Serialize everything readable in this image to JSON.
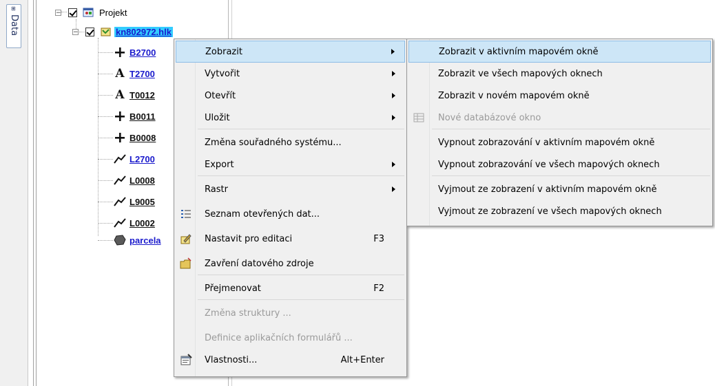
{
  "side_tab": {
    "label": "Data"
  },
  "tree": {
    "root": {
      "label": "Projekt"
    },
    "selected": {
      "label": "kn802972.hlk"
    },
    "layers": [
      {
        "name": "B2700",
        "icon": "plus",
        "color": "link"
      },
      {
        "name": "T2700",
        "icon": "text-A",
        "color": "link"
      },
      {
        "name": "T0012",
        "icon": "text-A",
        "color": "dark"
      },
      {
        "name": "B0011",
        "icon": "plus",
        "color": "dark"
      },
      {
        "name": "B0008",
        "icon": "plus",
        "color": "dark"
      },
      {
        "name": "L2700",
        "icon": "line",
        "color": "link"
      },
      {
        "name": "L0008",
        "icon": "line",
        "color": "dark"
      },
      {
        "name": "L9005",
        "icon": "line",
        "color": "dark"
      },
      {
        "name": "L0002",
        "icon": "line",
        "color": "dark"
      },
      {
        "name": "parcela",
        "icon": "polygon",
        "color": "link"
      }
    ]
  },
  "context_menu": {
    "items": [
      {
        "label": "Zobrazit",
        "submenu": true,
        "highlighted": true
      },
      {
        "label": "Vytvořit",
        "submenu": true
      },
      {
        "label": "Otevřít",
        "submenu": true
      },
      {
        "label": "Uložit",
        "submenu": true
      },
      {
        "label": "Změna souřadného systému..."
      },
      {
        "label": "Export",
        "submenu": true
      },
      {
        "label": "Rastr",
        "submenu": true
      },
      {
        "label": "Seznam otevřených dat...",
        "icon": "list-icon"
      },
      {
        "label": "Nastavit pro editaci",
        "shortcut": "F3",
        "icon": "edit-icon"
      },
      {
        "label": "Zavření datového zdroje",
        "icon": "folder-close-icon"
      },
      {
        "label": "Přejmenovat",
        "shortcut": "F2"
      },
      {
        "label": "Změna struktury ...",
        "disabled": true
      },
      {
        "label": "Definice aplikačních formulářů ...",
        "disabled": true
      },
      {
        "label": "Vlastnosti...",
        "shortcut": "Alt+Enter",
        "icon": "properties-icon"
      }
    ]
  },
  "submenu": {
    "items": [
      {
        "label": "Zobrazit v aktivním mapovém okně",
        "highlighted": true
      },
      {
        "label": "Zobrazit ve všech mapových oknech"
      },
      {
        "label": "Zobrazit v novém mapovém okně"
      },
      {
        "label": "Nové databázové okno",
        "disabled": true,
        "icon": "table-icon"
      },
      {
        "label": "Vypnout zobrazování v aktivním mapovém okně"
      },
      {
        "label": "Vypnout zobrazování ve všech mapových oknech"
      },
      {
        "label": "Vyjmout ze zobrazení v aktivním mapovém okně"
      },
      {
        "label": "Vyjmout ze zobrazení ve všech mapových oknech"
      }
    ]
  },
  "colors": {
    "highlight": "#cde6f7",
    "highlight_border": "#8cbce6",
    "selection": "#33ccff",
    "link": "#1a1acc"
  }
}
